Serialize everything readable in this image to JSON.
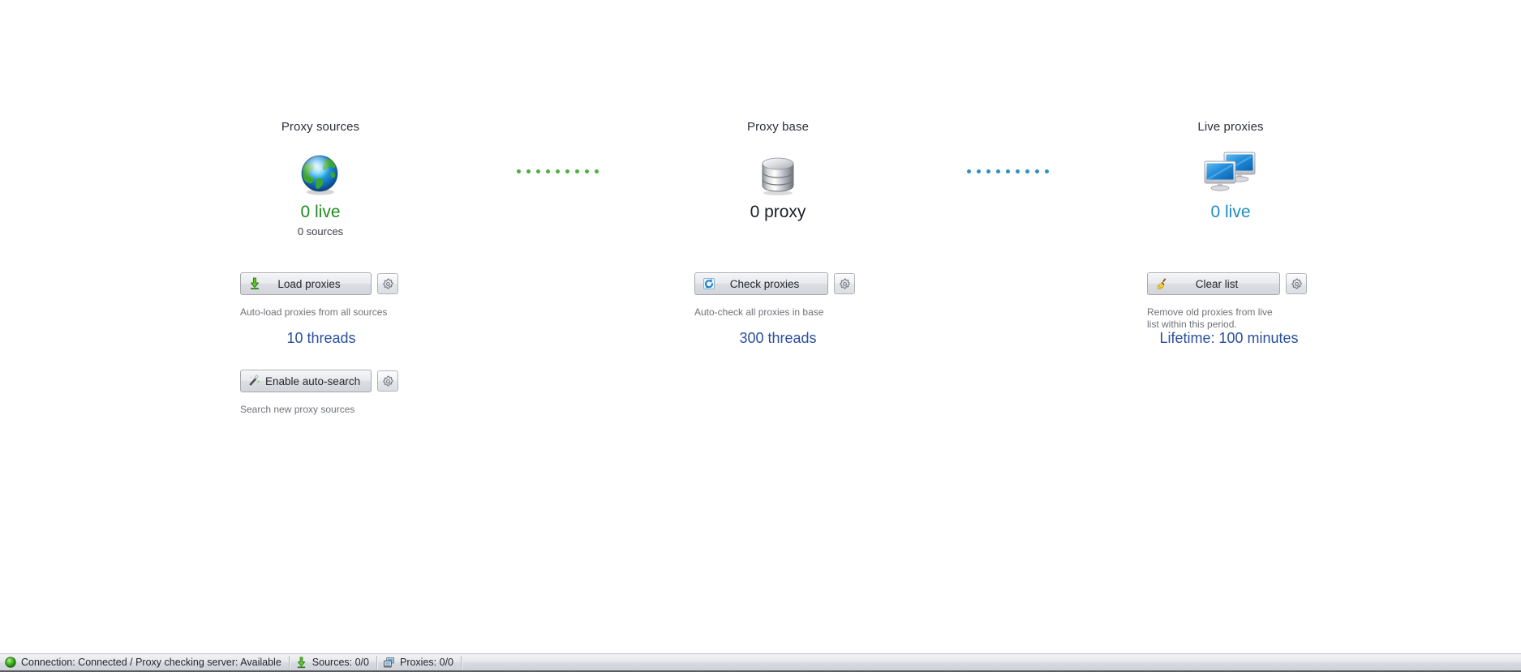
{
  "columns": [
    {
      "id": "proxy-sources",
      "title": "Proxy sources",
      "icon": "globe-icon",
      "count": "0 live",
      "count_color": "#1e8c1e",
      "subcount": "0 sources",
      "actions": [
        {
          "label": "Load proxies",
          "icon": "download-arrow-icon",
          "settings_icon": "gear-icon",
          "hint": "Auto-load proxies from all sources",
          "threads": "10 threads"
        },
        {
          "label": "Enable auto-search",
          "icon": "magic-wand-icon",
          "settings_icon": "gear-icon",
          "hint": "Search new proxy sources",
          "threads": ""
        }
      ]
    },
    {
      "id": "proxy-base",
      "title": "Proxy base",
      "icon": "database-icon",
      "count": "0 proxy",
      "count_color": "#1c1f28",
      "subcount": "",
      "actions": [
        {
          "label": "Check proxies",
          "icon": "refresh-icon",
          "settings_icon": "gear-icon",
          "hint": "Auto-check all proxies in base",
          "threads": "300 threads"
        }
      ]
    },
    {
      "id": "live-proxies",
      "title": "Live proxies",
      "icon": "monitors-icon",
      "count": "0 live",
      "count_color": "#1f8dc4",
      "subcount": "",
      "actions": [
        {
          "label": "Clear list",
          "icon": "broom-icon",
          "settings_icon": "gear-icon",
          "hint": "Remove old proxies from live list within this period.",
          "threads": "Lifetime: 100 minutes"
        }
      ]
    }
  ],
  "connectors": [
    {
      "id": "sources-to-base",
      "color": "#4caf3e",
      "dot_count": 9
    },
    {
      "id": "base-to-live",
      "color": "#2b8fc6",
      "dot_count": 9
    }
  ],
  "statusbar": {
    "connection_indicator": "green-circle-icon",
    "connection_text": "Connection: Connected / Proxy checking server: Available",
    "sources_icon": "download-arrow-icon",
    "sources_text": "Sources: 0/0",
    "proxies_icon": "proxies-icon",
    "proxies_text": "Proxies: 0/0"
  }
}
